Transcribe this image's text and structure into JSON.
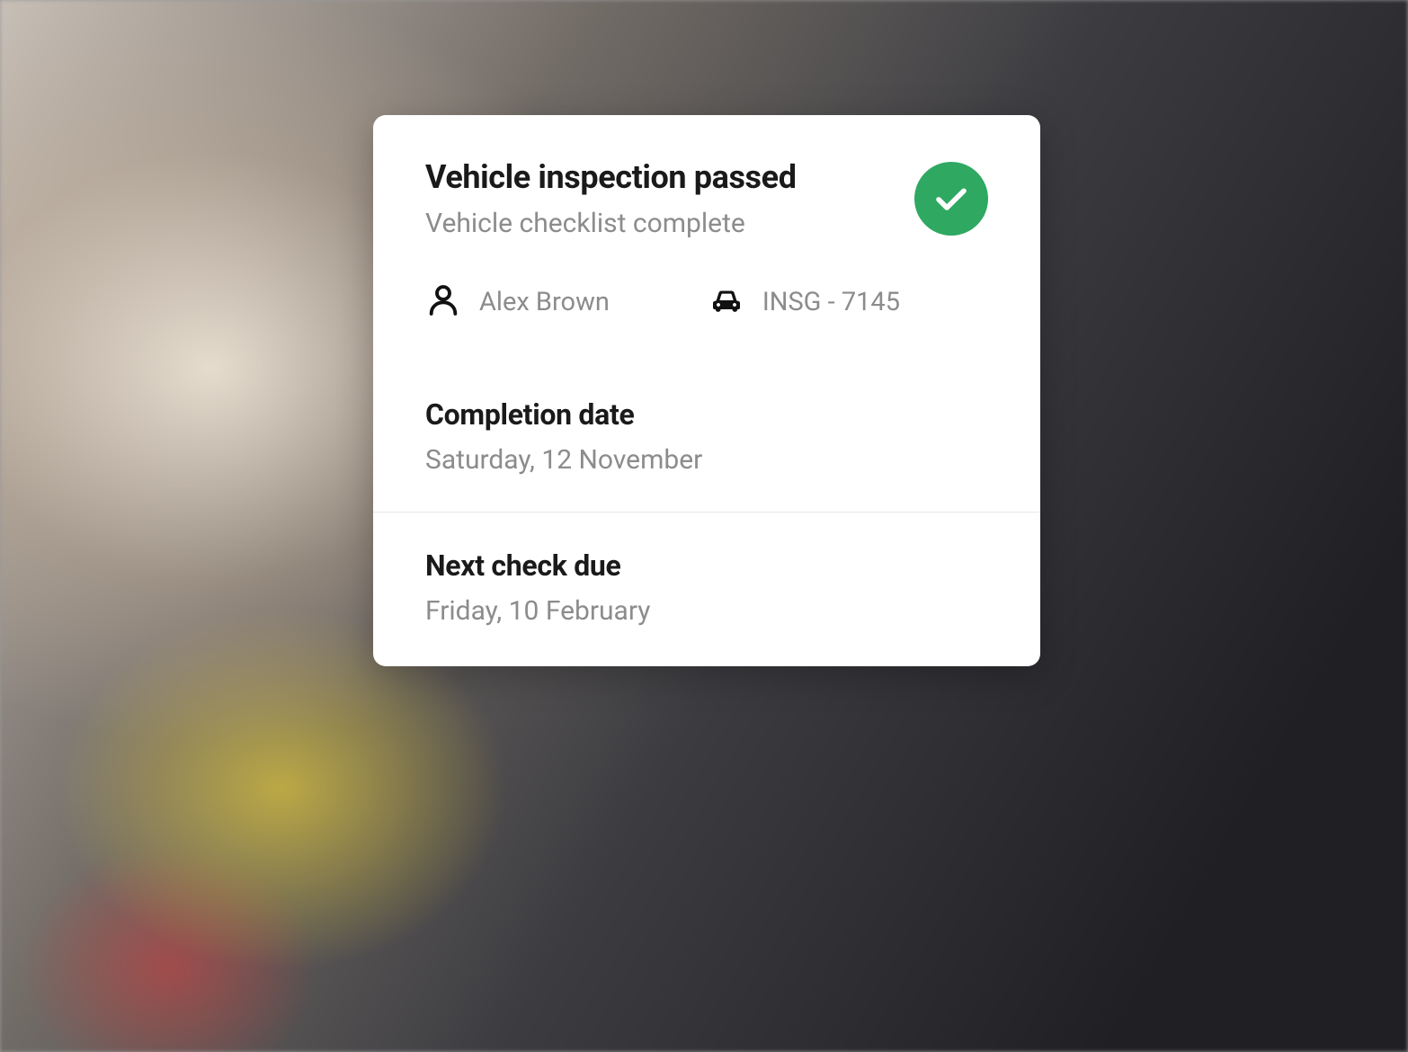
{
  "card": {
    "title": "Vehicle inspection passed",
    "subtitle": "Vehicle checklist complete",
    "inspector": "Alex Brown",
    "vehicle_id": "INSG - 7145",
    "completion": {
      "label": "Completion date",
      "value": "Saturday, 12 November"
    },
    "next_check": {
      "label": "Next check due",
      "value": "Friday, 10 February"
    },
    "status_color": "#2fa862"
  }
}
